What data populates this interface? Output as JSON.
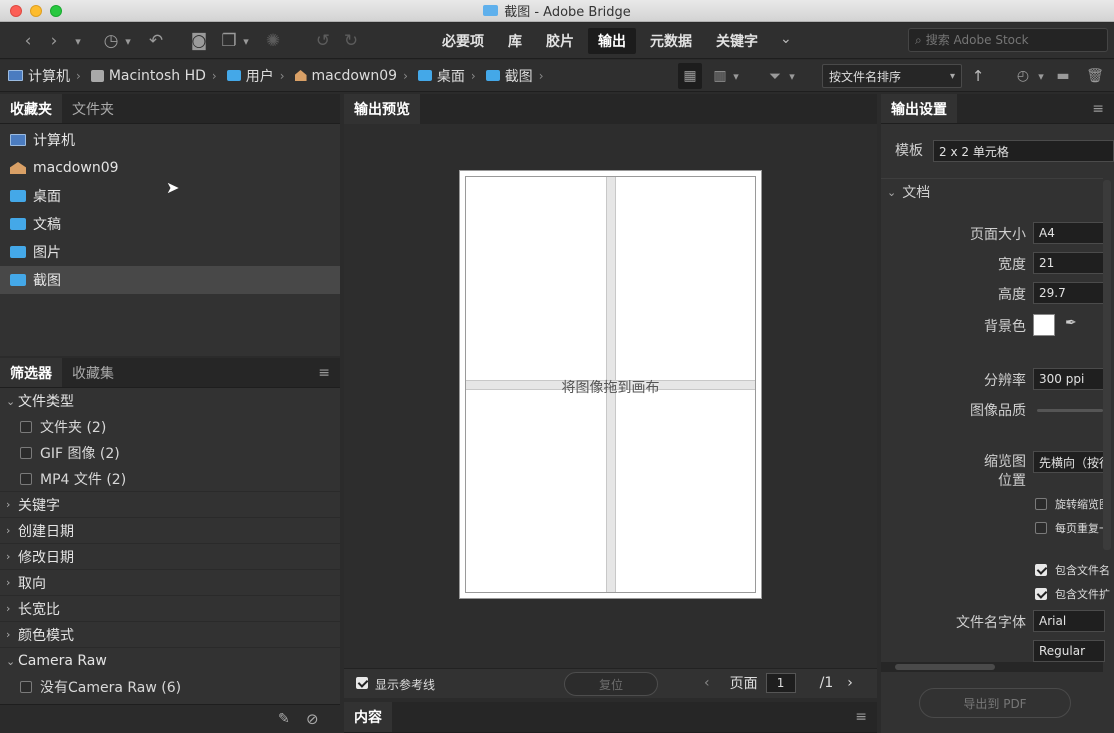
{
  "window": {
    "title": "截图 - Adobe Bridge"
  },
  "toolbar": {
    "workspaces": [
      "必要项",
      "库",
      "胶片",
      "输出",
      "元数据",
      "关键字"
    ],
    "active_workspace": "输出",
    "search_placeholder": "搜索 Adobe Stock"
  },
  "path": {
    "crumbs": [
      "计算机",
      "Macintosh HD",
      "用户",
      "macdown09",
      "桌面",
      "截图"
    ],
    "sort_label": "按文件名排序"
  },
  "favorites_panel": {
    "tabs": [
      "收藏夹",
      "文件夹"
    ],
    "items": [
      "计算机",
      "macdown09",
      "桌面",
      "文稿",
      "图片",
      "截图"
    ],
    "selected": "截图"
  },
  "filter_panel": {
    "tabs": [
      "筛选器",
      "收藏集"
    ],
    "file_type": {
      "label": "文件类型",
      "options": [
        "文件夹 (2)",
        "GIF 图像 (2)",
        "MP4 文件 (2)"
      ]
    },
    "sections": [
      "关键字",
      "创建日期",
      "修改日期",
      "取向",
      "长宽比",
      "颜色模式"
    ],
    "camera_raw": {
      "label": "Camera Raw",
      "options": [
        "没有Camera Raw (6)"
      ]
    }
  },
  "preview": {
    "tab": "输出预览",
    "drop_text": "将图像拖到画布",
    "show_guides": "显示参考线",
    "reset": "复位",
    "page_label": "页面",
    "page_current": "1",
    "page_total": "/1"
  },
  "content_panel": {
    "tab": "内容"
  },
  "settings": {
    "tab": "输出设置",
    "template_label": "模板",
    "template_value": "2 x 2 单元格",
    "section_doc": "文档",
    "page_size_label": "页面大小",
    "page_size_value": "A4",
    "width_label": "宽度",
    "width_value": "21",
    "height_label": "高度",
    "height_value": "29.7",
    "bg_label": "背景色",
    "resolution_label": "分辨率",
    "resolution_value": "300 ppi",
    "quality_label": "图像品质",
    "thumb_pos_label_1": "缩览图",
    "thumb_pos_label_2": "位置",
    "thumb_pos_value": "先横向（按行",
    "opt_rotate": "旋转缩览图",
    "opt_repeat": "每页重复一",
    "opt_include_1": "包含文件名",
    "opt_include_2": "包含文件扩",
    "font_label": "文件名字体",
    "font_value": "Arial",
    "font_style": "Regular",
    "export_button": "导出到 PDF"
  },
  "colors": {
    "accent": "#44a8e8",
    "panel": "#323232",
    "tab_bar": "#262626"
  }
}
